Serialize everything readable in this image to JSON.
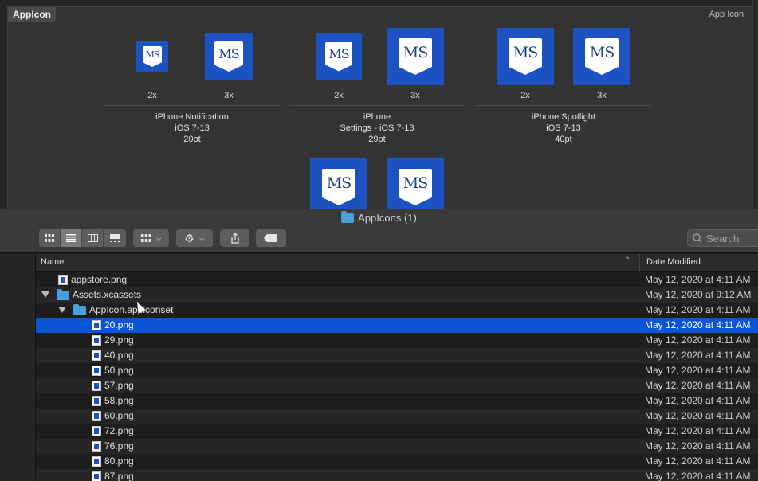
{
  "asset_catalog": {
    "title": "AppIcon",
    "type_label": "App Icon",
    "icon_text": "MS",
    "groups": [
      {
        "line1": "iPhone Notification",
        "line2": "iOS 7-13",
        "line3": "20pt",
        "scales": [
          "2x",
          "3x"
        ]
      },
      {
        "line1": "iPhone",
        "line2": "Settings - iOS 7-13",
        "line3": "29pt",
        "scales": [
          "2x",
          "3x"
        ]
      },
      {
        "line1": "iPhone Spotlight",
        "line2": "iOS 7-13",
        "line3": "40pt",
        "scales": [
          "2x",
          "3x"
        ]
      }
    ]
  },
  "finder": {
    "window_title": "AppIcons (1)",
    "search_placeholder": "Search",
    "columns": {
      "name": "Name",
      "date": "Date Modified"
    },
    "rows": [
      {
        "name": "appstore.png",
        "date": "May 12, 2020 at 4:11 AM",
        "kind": "png",
        "indent": 0
      },
      {
        "name": "Assets.xcassets",
        "date": "May 12, 2020 at 9:12 AM",
        "kind": "folder",
        "indent": 0,
        "expanded": true
      },
      {
        "name": "AppIcon.appiconset",
        "date": "May 12, 2020 at 4:11 AM",
        "kind": "folder",
        "indent": 1,
        "expanded": true
      },
      {
        "name": "20.png",
        "date": "May 12, 2020 at 4:11 AM",
        "kind": "png",
        "indent": 2,
        "selected": true
      },
      {
        "name": "29.png",
        "date": "May 12, 2020 at 4:11 AM",
        "kind": "png",
        "indent": 2
      },
      {
        "name": "40.png",
        "date": "May 12, 2020 at 4:11 AM",
        "kind": "png",
        "indent": 2
      },
      {
        "name": "50.png",
        "date": "May 12, 2020 at 4:11 AM",
        "kind": "png",
        "indent": 2
      },
      {
        "name": "57.png",
        "date": "May 12, 2020 at 4:11 AM",
        "kind": "png",
        "indent": 2
      },
      {
        "name": "58.png",
        "date": "May 12, 2020 at 4:11 AM",
        "kind": "png",
        "indent": 2
      },
      {
        "name": "60.png",
        "date": "May 12, 2020 at 4:11 AM",
        "kind": "png",
        "indent": 2
      },
      {
        "name": "72.png",
        "date": "May 12, 2020 at 4:11 AM",
        "kind": "png",
        "indent": 2
      },
      {
        "name": "76.png",
        "date": "May 12, 2020 at 4:11 AM",
        "kind": "png",
        "indent": 2
      },
      {
        "name": "80.png",
        "date": "May 12, 2020 at 4:11 AM",
        "kind": "png",
        "indent": 2
      },
      {
        "name": "87.png",
        "date": "May 12, 2020 at 4:11 AM",
        "kind": "png",
        "indent": 2
      }
    ]
  },
  "colors": {
    "selection": "#0a54d6",
    "icon_blue": "#1d52c2",
    "folder": "#4aa0d8"
  }
}
